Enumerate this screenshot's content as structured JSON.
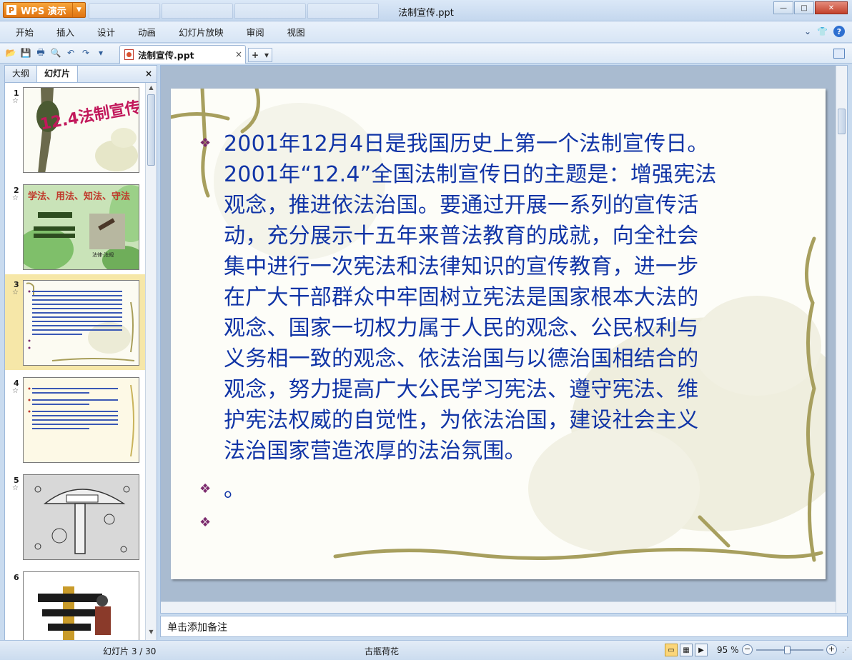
{
  "app": {
    "name": "WPS 演示",
    "logo_glyph": "P",
    "window_title": "法制宣传.ppt",
    "accent": "#e07310"
  },
  "window_controls": {
    "minimize": "—",
    "maximize": "□",
    "close": "✕"
  },
  "menu": {
    "items": [
      "开始",
      "插入",
      "设计",
      "动画",
      "幻灯片放映",
      "审阅",
      "视图"
    ]
  },
  "document_tab": {
    "label": "法制宣传.ppt",
    "close": "×",
    "new_tab": "+"
  },
  "left_panel": {
    "tabs": [
      "大纲",
      "幻灯片"
    ],
    "active_tab": "幻灯片",
    "close": "×",
    "thumbnails": [
      {
        "num": "1",
        "title": "12.4法制宣传"
      },
      {
        "num": "2",
        "line1": "学法、用法、知法、守法",
        "caption": "法律·法规"
      },
      {
        "num": "3",
        "selected": true
      },
      {
        "num": "4"
      },
      {
        "num": "5"
      },
      {
        "num": "6"
      }
    ]
  },
  "slide": {
    "paragraphs": [
      "2001年12月4日是我国历史上第一个法制宣传日。2001年“12.4”全国法制宣传日的主题是：增强宪法观念，推进依法治国。要通过开展一系列的宣传活动，充分展示十五年来普法教育的成就，向全社会集中进行一次宪法和法律知识的宣传教育，进一步在广大干部群众中牢固树立宪法是国家根本大法的观念、国家一切权力属于人民的观念、公民权利与义务相一致的观念、依法治国与以德治国相结合的观念，努力提高广大公民学习宪法、遵守宪法、维护宪法权威的自觉性，为依法治国，建设社会主义法治国家营造浓厚的法治氛围。",
      "。",
      ""
    ],
    "lines": [
      "2001年12月4日是我国历史上第一个法制宣传日。",
      "2001年“12.4”全国法制宣传日的主题是：增强宪法",
      "观念，推进依法治国。要通过开展一系列的宣传活",
      "动，充分展示十五年来普法教育的成就，向全社会",
      "集中进行一次宪法和法律知识的宣传教育，进一步",
      "在广大干部群众中牢固树立宪法是国家根本大法的",
      "观念、国家一切权力属于人民的观念、公民权利与",
      "义务相一致的观念、依法治国与以德治国相结合的",
      "观念，努力提高广大公民学习宪法、遵守宪法、维",
      "护宪法权威的自觉性，为依法治国，建设社会主义",
      "法治国家营造浓厚的法治氛围。"
    ],
    "bullet_glyph": "❖",
    "text_color": "#1034a6",
    "bullet_color": "#7b2a6d"
  },
  "notes": {
    "placeholder": "单击添加备注"
  },
  "status": {
    "slide_indicator": "幻灯片 3 / 30",
    "theme": "古瓶荷花",
    "zoom": "95 %",
    "zoom_minus": "−",
    "zoom_plus": "+"
  }
}
